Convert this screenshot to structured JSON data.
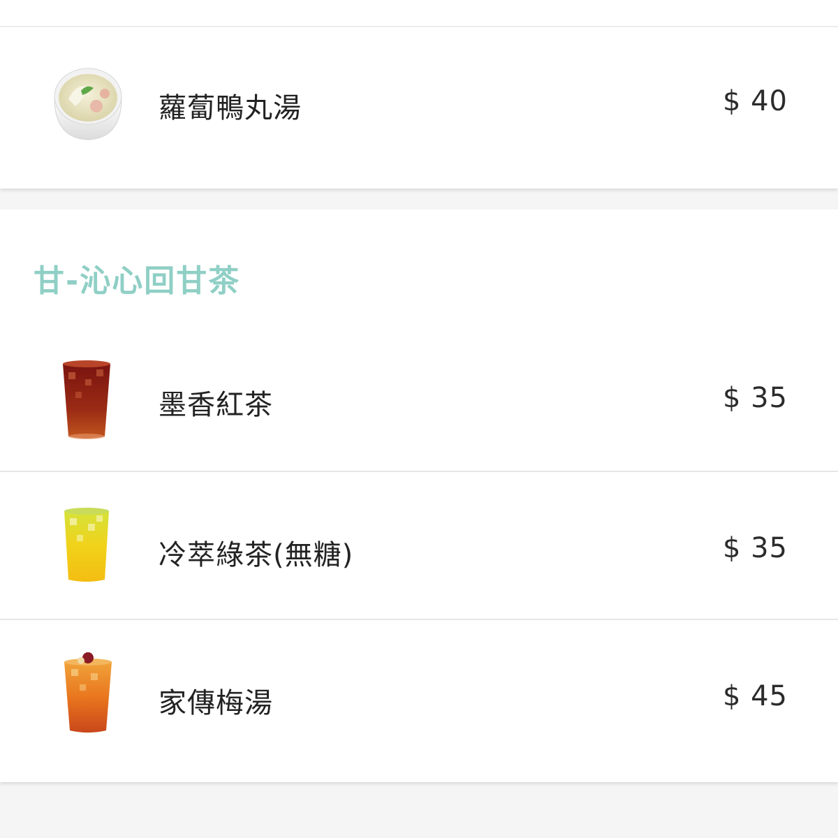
{
  "prev_section": {
    "items": [
      {
        "name": "蘿蔔鴨丸湯",
        "price": "$ 40",
        "image": "radish-duck-ball-soup-bowl"
      }
    ]
  },
  "section": {
    "title": "甘-沁心回甘茶",
    "items": [
      {
        "name": "墨香紅茶",
        "price": "$ 35",
        "image": "black-tea-cup"
      },
      {
        "name": "冷萃綠茶(無糖)",
        "price": "$ 35",
        "image": "cold-brew-green-tea-cup"
      },
      {
        "name": "家傳梅湯",
        "price": "$ 45",
        "image": "plum-drink-cup"
      }
    ]
  },
  "colors": {
    "section_title": "#8fcfc5",
    "background": "#f5f5f5",
    "card": "#ffffff"
  }
}
